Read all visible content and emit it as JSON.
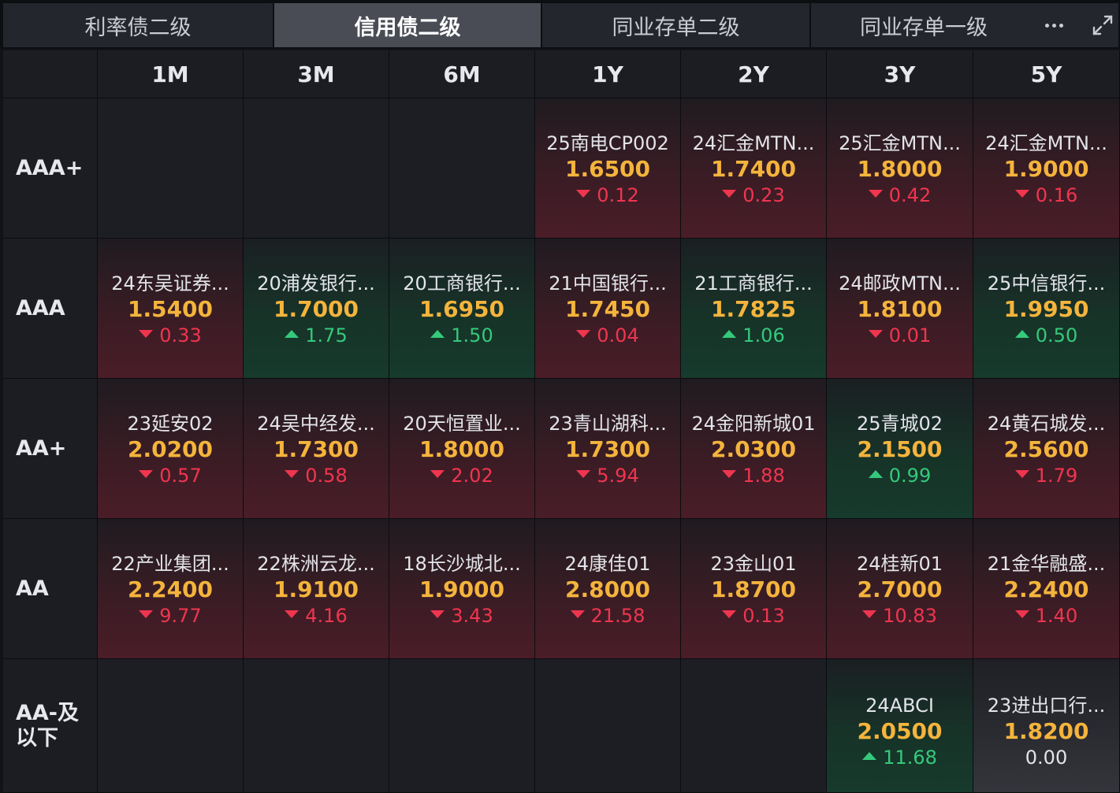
{
  "tabs": [
    {
      "label": "利率债二级",
      "active": false
    },
    {
      "label": "信用债二级",
      "active": true
    },
    {
      "label": "同业存单二级",
      "active": false
    },
    {
      "label": "同业存单一级",
      "active": false
    }
  ],
  "tenors": [
    "1M",
    "3M",
    "6M",
    "1Y",
    "2Y",
    "3Y",
    "5Y"
  ],
  "rows": [
    {
      "rating": "AAA+",
      "cells": [
        null,
        null,
        null,
        {
          "name": "25南电CP002",
          "yield": "1.6500",
          "change": "0.12",
          "dir": "down"
        },
        {
          "name": "24汇金MTN...",
          "yield": "1.7400",
          "change": "0.23",
          "dir": "down"
        },
        {
          "name": "25汇金MTN...",
          "yield": "1.8000",
          "change": "0.42",
          "dir": "down"
        },
        {
          "name": "24汇金MTN...",
          "yield": "1.9000",
          "change": "0.16",
          "dir": "down"
        }
      ]
    },
    {
      "rating": "AAA",
      "cells": [
        {
          "name": "24东吴证券...",
          "yield": "1.5400",
          "change": "0.33",
          "dir": "down"
        },
        {
          "name": "20浦发银行...",
          "yield": "1.7000",
          "change": "1.75",
          "dir": "up"
        },
        {
          "name": "20工商银行...",
          "yield": "1.6950",
          "change": "1.50",
          "dir": "up"
        },
        {
          "name": "21中国银行...",
          "yield": "1.7450",
          "change": "0.04",
          "dir": "down"
        },
        {
          "name": "21工商银行...",
          "yield": "1.7825",
          "change": "1.06",
          "dir": "up"
        },
        {
          "name": "24邮政MTN...",
          "yield": "1.8100",
          "change": "0.01",
          "dir": "down"
        },
        {
          "name": "25中信银行...",
          "yield": "1.9950",
          "change": "0.50",
          "dir": "up"
        }
      ]
    },
    {
      "rating": "AA+",
      "cells": [
        {
          "name": "23延安02",
          "yield": "2.0200",
          "change": "0.57",
          "dir": "down"
        },
        {
          "name": "24吴中经发...",
          "yield": "1.7300",
          "change": "0.58",
          "dir": "down"
        },
        {
          "name": "20天恒置业...",
          "yield": "1.8000",
          "change": "2.02",
          "dir": "down"
        },
        {
          "name": "23青山湖科...",
          "yield": "1.7300",
          "change": "5.94",
          "dir": "down"
        },
        {
          "name": "24金阳新城01",
          "yield": "2.0300",
          "change": "1.88",
          "dir": "down"
        },
        {
          "name": "25青城02",
          "yield": "2.1500",
          "change": "0.99",
          "dir": "up"
        },
        {
          "name": "24黄石城发...",
          "yield": "2.5600",
          "change": "1.79",
          "dir": "down"
        }
      ]
    },
    {
      "rating": "AA",
      "cells": [
        {
          "name": "22产业集团...",
          "yield": "2.2400",
          "change": "9.77",
          "dir": "down"
        },
        {
          "name": "22株洲云龙...",
          "yield": "1.9100",
          "change": "4.16",
          "dir": "down"
        },
        {
          "name": "18长沙城北...",
          "yield": "1.9000",
          "change": "3.43",
          "dir": "down"
        },
        {
          "name": "24康佳01",
          "yield": "2.8000",
          "change": "21.58",
          "dir": "down"
        },
        {
          "name": "23金山01",
          "yield": "1.8700",
          "change": "0.13",
          "dir": "down"
        },
        {
          "name": "24桂新01",
          "yield": "2.7000",
          "change": "10.83",
          "dir": "down"
        },
        {
          "name": "21金华融盛...",
          "yield": "2.2400",
          "change": "1.40",
          "dir": "down"
        }
      ]
    },
    {
      "rating": "AA-及以下",
      "cells": [
        null,
        null,
        null,
        null,
        null,
        {
          "name": "24ABCI",
          "yield": "2.0500",
          "change": "11.68",
          "dir": "up"
        },
        {
          "name": "23进出口行...",
          "yield": "1.8200",
          "change": "0.00",
          "dir": "flat"
        }
      ]
    }
  ],
  "colors": {
    "down": "#f0354f",
    "up": "#35c97b",
    "yield": "#f4b43c"
  },
  "icons": [
    "more-icon",
    "expand-icon",
    "arrow-down-icon",
    "arrow-up-icon"
  ]
}
